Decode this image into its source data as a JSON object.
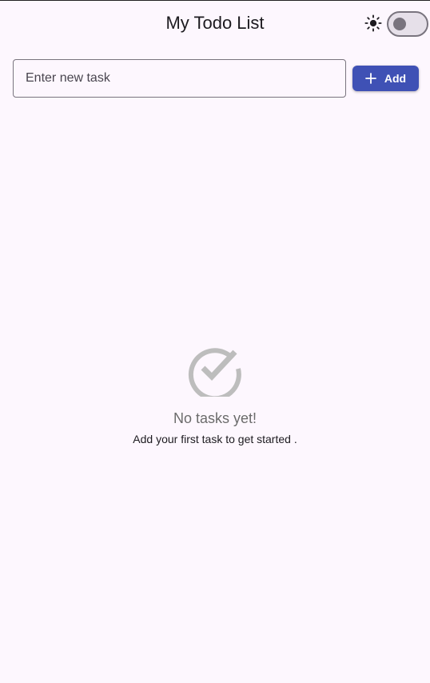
{
  "app_bar": {
    "title": "My Todo List",
    "theme_icon": "sun-icon",
    "dark_mode_toggle": {
      "on": false
    }
  },
  "new_task": {
    "placeholder": "Enter new task",
    "value": "",
    "add_button_label": "Add",
    "add_button_icon": "plus-icon"
  },
  "empty_state": {
    "icon": "check-circle-icon",
    "title": "No tasks yet!",
    "subtitle": "Add your first task to get started ."
  },
  "colors": {
    "background": "#fdf7fe",
    "accent": "#3f51b5",
    "empty_icon": "#bdbdbd"
  }
}
